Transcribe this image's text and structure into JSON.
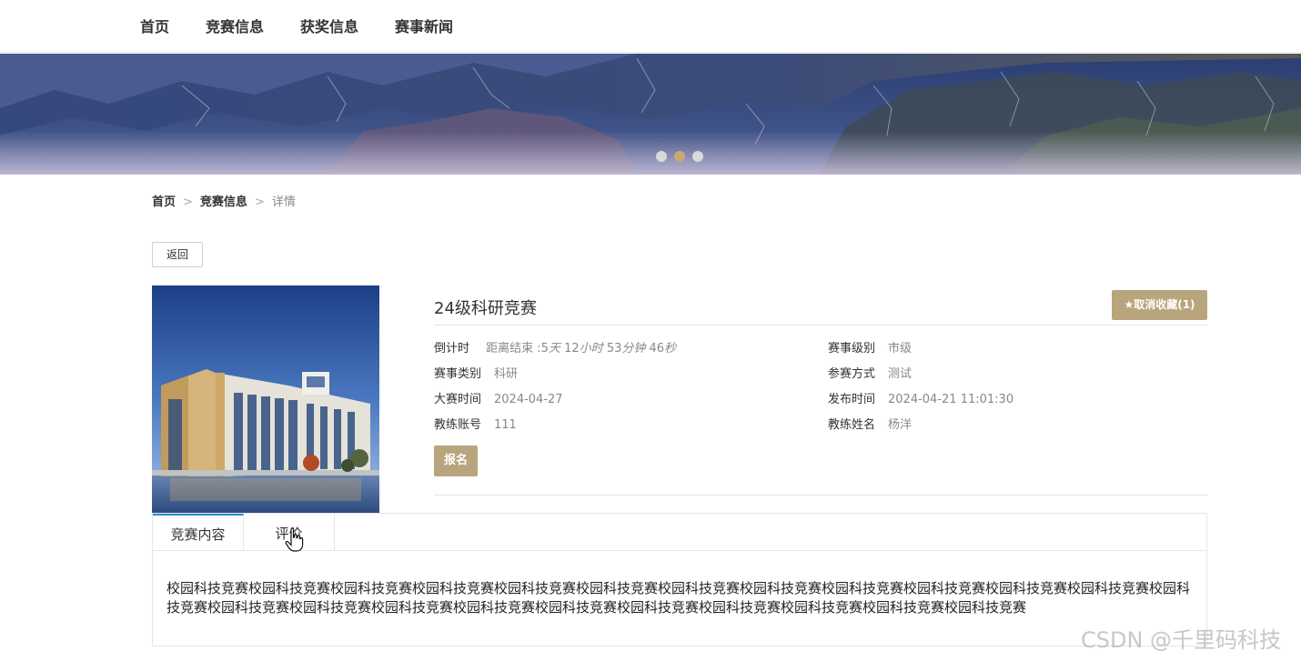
{
  "nav": {
    "items": [
      "首页",
      "竞赛信息",
      "获奖信息",
      "赛事新闻"
    ]
  },
  "banner": {
    "slide_count": 3,
    "active_slide": 1,
    "colors": {
      "dot": "#d9d9d9",
      "dot_active": "#c8ab72"
    }
  },
  "breadcrumb": {
    "home": "首页",
    "section": "竞赛信息",
    "current": "详情",
    "separator": ">"
  },
  "back_button": "返回",
  "competition": {
    "title": "24级科研竞赛",
    "favorite_button": "★取消收藏(1)",
    "countdown_label": "倒计时",
    "countdown_prefix": "距离结束 :",
    "countdown": {
      "days": "5",
      "days_unit": "天",
      "hours": "12",
      "hours_unit": "小时",
      "minutes": "53",
      "minutes_unit": "分钟",
      "seconds": "46",
      "seconds_unit": "秒"
    },
    "level_label": "赛事级别",
    "level": "市级",
    "category_label": "赛事类别",
    "category": "科研",
    "mode_label": "参赛方式",
    "mode": "测试",
    "date_label": "大赛时间",
    "date": "2024-04-27",
    "publish_label": "发布时间",
    "publish_time": "2024-04-21 11:01:30",
    "coach_account_label": "教练账号",
    "coach_account": "111",
    "coach_name_label": "教练姓名",
    "coach_name": "杨洋",
    "signup_button": "报名"
  },
  "tabs": {
    "items": [
      "竞赛内容",
      "评价"
    ],
    "active": 0,
    "content": "校园科技竞赛校园科技竞赛校园科技竞赛校园科技竞赛校园科技竞赛校园科技竞赛校园科技竞赛校园科技竞赛校园科技竞赛校园科技竞赛校园科技竞赛校园科技竞赛校园科技竞赛校园科技竞赛校园科技竞赛校园科技竞赛校园科技竞赛校园科技竞赛校园科技竞赛校园科技竞赛校园科技竞赛校园科技竞赛校园科技竞赛"
  },
  "watermark": "CSDN @千里码科技",
  "accent_colors": {
    "gold": "#b9a57d",
    "tab_active": "#2a8ad0"
  }
}
